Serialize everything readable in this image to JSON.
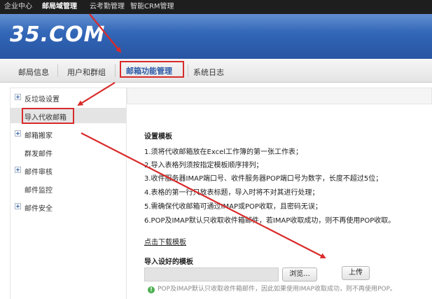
{
  "topnav": {
    "items": [
      "企业中心",
      "邮局域管理",
      "云考勤管理",
      "智能CRM管理"
    ],
    "active_index": 1
  },
  "header": {
    "logo": "35.COM"
  },
  "tabs": {
    "items": [
      "邮局信息",
      "用户和群组",
      "邮箱功能管理",
      "系统日志"
    ],
    "active_index": 2
  },
  "sidebar": {
    "items": [
      {
        "label": "反垃圾设置",
        "expandable": true
      },
      {
        "label": "导入代收邮箱",
        "expandable": false,
        "active": true
      },
      {
        "label": "邮箱搬家",
        "expandable": true
      },
      {
        "label": "群发邮件",
        "expandable": false
      },
      {
        "label": "邮件审核",
        "expandable": true
      },
      {
        "label": "邮件监控",
        "expandable": false
      },
      {
        "label": "邮件安全",
        "expandable": true
      }
    ]
  },
  "content": {
    "section_title": "设置模板",
    "rules": [
      "1.须将代收邮箱放在Excel工作簿的第一张工作表；",
      "2.导入表格列须按指定模板顺序排列；",
      "3.收件服务器IMAP端口号、收件服务器POP端口号为数字，长度不超过5位；",
      "4.表格的第一行只放表标题，导入时将不对其进行处理；",
      "5.需确保代收邮箱可通过IMAP或POP收取，且密码无误；",
      "6.POP及IMAP默认只收取收件箱邮件，若IMAP收取成功，则不再使用POP收取。"
    ],
    "download_link": "点击下载模板",
    "import_label": "导入设好的模板",
    "file_value": "",
    "browse_button": "浏览...",
    "upload_button": "上传",
    "note": "POP及IMAP默认只收取收件箱邮件，因此如果使用IMAP收取成功，则不再使用POP。"
  },
  "colors": {
    "highlight_red": "#d92b2b",
    "header_blue": "#3563b0",
    "active_tab_text": "#2c5aa8"
  }
}
